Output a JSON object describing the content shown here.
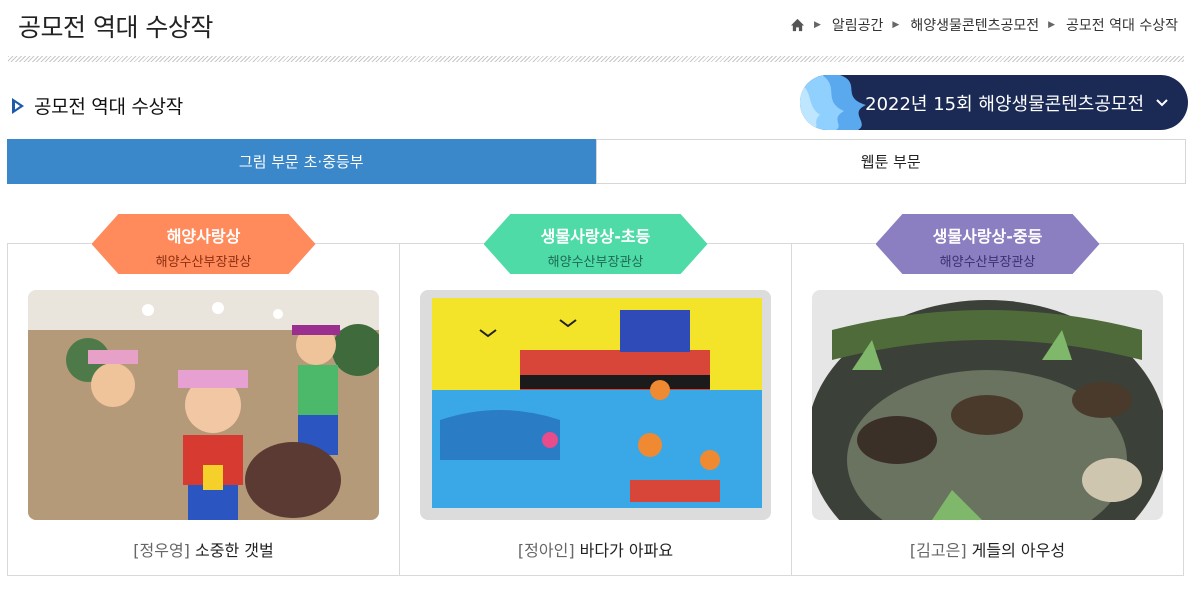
{
  "header": {
    "page_title": "공모전 역대 수상작",
    "breadcrumb": [
      "알림공간",
      "해양생물콘텐츠공모전",
      "공모전 역대 수상작"
    ]
  },
  "section": {
    "title": "공모전 역대 수상작",
    "year_select": "2022년 15회 해양생물콘텐츠공모전"
  },
  "tabs": [
    {
      "label": "그림 부문 초·중등부",
      "active": true
    },
    {
      "label": "웹툰 부문",
      "active": false
    }
  ],
  "awards": [
    {
      "award": "해양사랑상",
      "sub": "해양수산부장관상",
      "author": "[정우영]",
      "work": "소중한 갯벌",
      "color": "#ff8a5b"
    },
    {
      "award": "생물사랑상-초등",
      "sub": "해양수산부장관상",
      "author": "[정아인]",
      "work": "바다가 아파요",
      "color": "#4fdba8"
    },
    {
      "award": "생물사랑상-중등",
      "sub": "해양수산부장관상",
      "author": "[김고은]",
      "work": "게들의 아우성",
      "color": "#8c7fc1"
    }
  ],
  "colors": {
    "tab_active": "#3a87c9",
    "select_bg": "#1b2a55"
  }
}
